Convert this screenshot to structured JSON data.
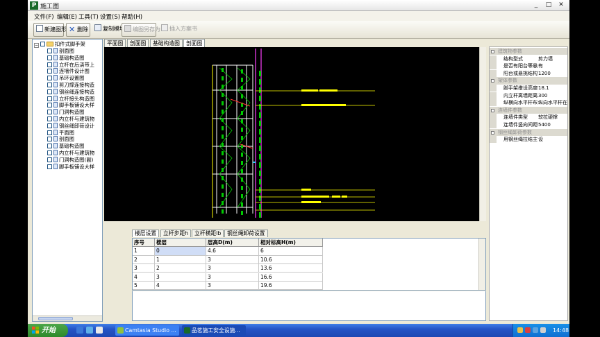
{
  "window": {
    "title": "施工图",
    "app_icon_glyph": "P",
    "min": "_",
    "max": "□",
    "close": "✕"
  },
  "menu": [
    {
      "label": "文件(F)"
    },
    {
      "label": "编辑(E)"
    },
    {
      "label": "工具(T)"
    },
    {
      "label": "设置(S)"
    },
    {
      "label": "帮助(H)"
    }
  ],
  "toolbar": {
    "new_label": "新建图形",
    "delete_label": "删除",
    "copy_label": "复制模块",
    "save_as_label": "编图另存为",
    "insert_label": "插入方案书"
  },
  "tree": {
    "root": "扣件式脚手架",
    "items": [
      "剖面图",
      "基础构造图",
      "立杆在后浇带上",
      "连墙件设计图",
      "吊环设置图",
      "剪刀撑连接构造",
      "钢丝绳连接构造",
      "立杆接头构造图",
      "脚手板铺设大样",
      "门洞构造图",
      "内立杆与建筑物",
      "钢丝绳卸荷设计",
      "平面图",
      "剖面图",
      "基础构造图",
      "内立杆与建筑物",
      "门洞构造图(副)",
      "脚手板铺设大样"
    ]
  },
  "drawing_tabs": [
    "平面图",
    "剖面图",
    "基础构造图",
    "剖面图"
  ],
  "properties": {
    "categories": [
      {
        "label": "建筑物参数",
        "rows": [
          {
            "key": "结构型式",
            "value": "剪力墙"
          },
          {
            "key": "是否有阳台等悬挑结构",
            "value": "有"
          },
          {
            "key": "阳台或悬挑结构宽度l4(mm)",
            "value": "1200"
          }
        ]
      },
      {
        "label": "架体参数",
        "rows": [
          {
            "key": "脚手架搭设高度H(m)",
            "value": "18.1"
          },
          {
            "key": "内立杆离墙距离a2(mm)",
            "value": "300"
          },
          {
            "key": "纵横向水平杆布置关系",
            "value": "纵向水平杆在"
          }
        ]
      },
      {
        "label": "连墙件参数",
        "rows": [
          {
            "key": "连墙件类型",
            "value": "软拉硬撑"
          },
          {
            "key": "连墙件竖向间距h2(mm)",
            "value": "5400"
          }
        ]
      },
      {
        "label": "钢丝绳卸荷参数",
        "rows": [
          {
            "key": "用钢丝绳拉结主节点对架体",
            "value": "设"
          }
        ]
      }
    ]
  },
  "bottom_tabs": [
    "楼层设置",
    "立杆步距h",
    "立杆横距lb",
    "钢丝绳卸荷设置"
  ],
  "table": {
    "headers": [
      "序号",
      "楼层",
      "层高D(m)",
      "相对标高H(m)"
    ],
    "rows": [
      [
        "1",
        "0",
        "4.6",
        "6"
      ],
      [
        "2",
        "1",
        "3",
        "10.6"
      ],
      [
        "3",
        "2",
        "3",
        "13.6"
      ],
      [
        "4",
        "3",
        "3",
        "16.6"
      ],
      [
        "5",
        "4",
        "3",
        "19.6"
      ]
    ]
  },
  "taskbar": {
    "start_label": "开始",
    "tasks": [
      "Camtasia Studio ...",
      "品茗施工安全设施..."
    ],
    "clock": "14:48"
  },
  "colors": {
    "canvas_bg": "#000000",
    "line_green": "#00cc00",
    "line_magenta": "#cc33cc",
    "line_yellow": "#ffff00",
    "line_white": "#ffffff",
    "line_red": "#ff3333",
    "taskbar_blue": "#245edb",
    "start_green": "#3c9a3a"
  }
}
